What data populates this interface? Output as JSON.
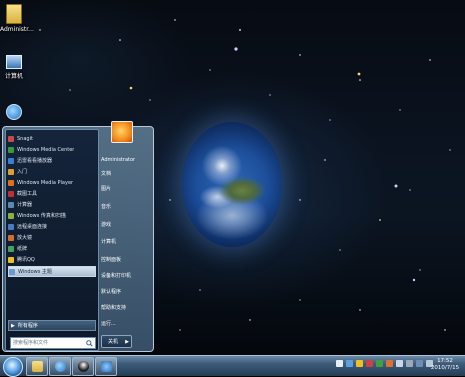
{
  "desktop": {
    "watermark": "",
    "icons": [
      {
        "label": "Administr..."
      },
      {
        "label": "计算机"
      },
      {
        "label": ""
      }
    ]
  },
  "start_menu": {
    "programs": [
      {
        "label": "Snagit"
      },
      {
        "label": "Windows Media Center"
      },
      {
        "label": "迅雷看看播放器"
      },
      {
        "label": "入门"
      },
      {
        "label": "Windows Media Player"
      },
      {
        "label": "截图工具"
      },
      {
        "label": "计算器"
      },
      {
        "label": "Windows 传真和扫描"
      },
      {
        "label": "远程桌面连接"
      },
      {
        "label": "放大镜"
      },
      {
        "label": "纸牌"
      },
      {
        "label": "腾讯QQ"
      },
      {
        "label": "Windows 主题"
      }
    ],
    "all_programs": "所有程序",
    "search_placeholder": "搜索程序和文件",
    "right_items": [
      {
        "label": "Administrator"
      },
      {
        "label": "文档"
      },
      {
        "label": "图片"
      },
      {
        "label": "音乐"
      },
      {
        "label": "游戏"
      },
      {
        "label": "计算机"
      },
      {
        "label": "控制面板"
      },
      {
        "label": "设备和打印机"
      },
      {
        "label": "默认程序"
      },
      {
        "label": "帮助和支持"
      },
      {
        "label": "运行..."
      }
    ],
    "shutdown_label": "关机",
    "shutdown_arrow": "▶"
  },
  "taskbar": {
    "clock_time": "17:52",
    "clock_date": "2010/7/15"
  },
  "colors": {
    "taskbar": "#3c5a78",
    "menu_left": "#14243a",
    "highlight": "#d7e4f0"
  }
}
